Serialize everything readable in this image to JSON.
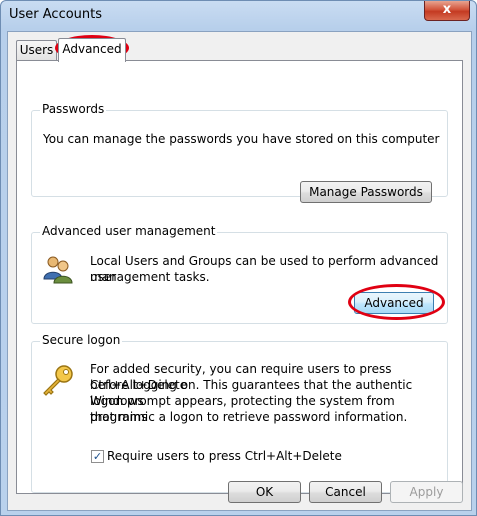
{
  "window": {
    "title": "User Accounts",
    "close_glyph": "x"
  },
  "tabs": [
    {
      "label": "Users"
    },
    {
      "label": "Advanced"
    }
  ],
  "passwords": {
    "heading": "Passwords",
    "description": "You can manage the passwords you have stored on this computer",
    "button_label": "Manage Passwords"
  },
  "advanced_mgmt": {
    "heading": "Advanced user management",
    "description_line1": "Local Users and Groups can be used to perform advanced user",
    "description_line2": "management tasks.",
    "button_label": "Advanced",
    "icon": "users-group-icon"
  },
  "secure_logon": {
    "heading": "Secure logon",
    "line1": "For added security, you can require users to press Ctrl+Alt+Delete",
    "line2": "before logging on. This guarantees that the authentic Windows",
    "line3": "logon prompt appears, protecting the system from programs",
    "line4": "that mimic a logon to retrieve password information.",
    "checkbox_label": "Require users to press Ctrl+Alt+Delete",
    "checkbox_checked": true,
    "icon": "key-icon"
  },
  "footer": {
    "ok_label": "OK",
    "cancel_label": "Cancel",
    "apply_label": "Apply"
  },
  "colors": {
    "annotation": "#e00012",
    "title_bar": "#b9d1ec",
    "close_button": "#c43a22"
  }
}
